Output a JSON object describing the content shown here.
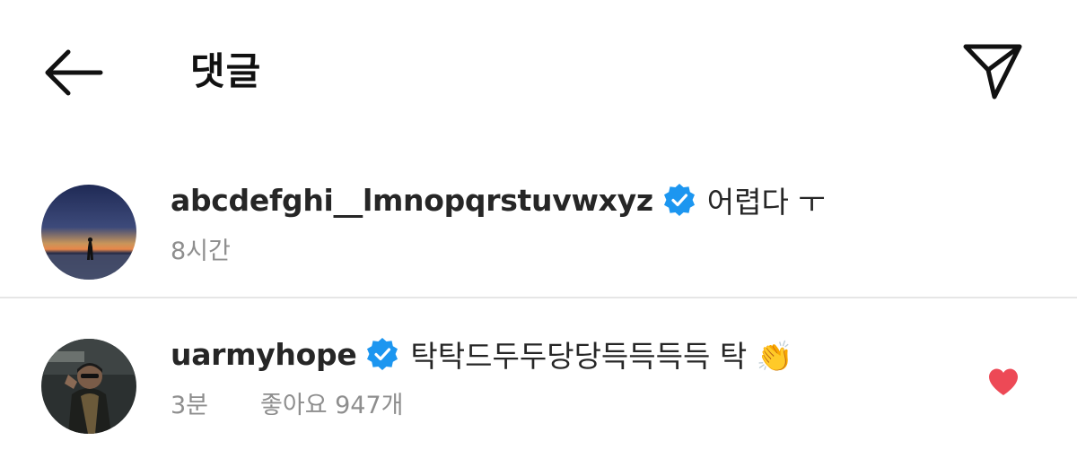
{
  "header": {
    "title": "댓글",
    "back_icon": "arrow-left-icon",
    "share_icon": "paper-plane-icon"
  },
  "comments": [
    {
      "username": "abcdefghi__lmnopqrstuvwxyz",
      "verified": true,
      "text": "어렵다 ㅜ",
      "time": "8시간",
      "likes": ""
    },
    {
      "username": "uarmyhope",
      "verified": true,
      "text": "탁탁드두두당당득득득득 탁 👏",
      "time": "3분",
      "likes": "좋아요 947개",
      "liked": true
    }
  ],
  "colors": {
    "verified_blue": "#1c96f0",
    "heart_red": "#ed4956",
    "meta_gray": "#8e8e8e",
    "text_dark": "#262626"
  }
}
